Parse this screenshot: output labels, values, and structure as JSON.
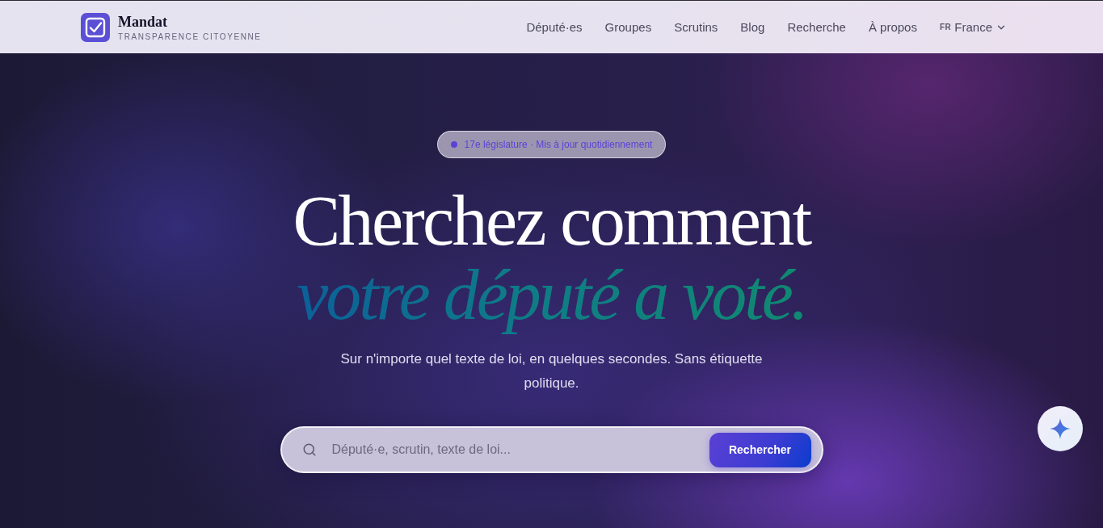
{
  "header": {
    "brand": {
      "name": "Mandat",
      "tagline": "TRANSPARENCE CITOYENNE"
    },
    "nav": [
      {
        "label": "Député·es"
      },
      {
        "label": "Groupes"
      },
      {
        "label": "Scrutins"
      },
      {
        "label": "Blog"
      },
      {
        "label": "Recherche"
      },
      {
        "label": "À propos"
      }
    ],
    "language": {
      "code": "FR",
      "label": "France"
    }
  },
  "hero": {
    "badge": "17e législature · Mis à jour quotidiennement",
    "title": "Cherchez comment",
    "title_accent": "votre député a voté.",
    "subtitle": "Sur n'importe quel texte de loi, en quelques secondes. Sans étiquette politique.",
    "search": {
      "placeholder": "Député·e, scrutin, texte de loi...",
      "button": "Rechercher"
    }
  }
}
